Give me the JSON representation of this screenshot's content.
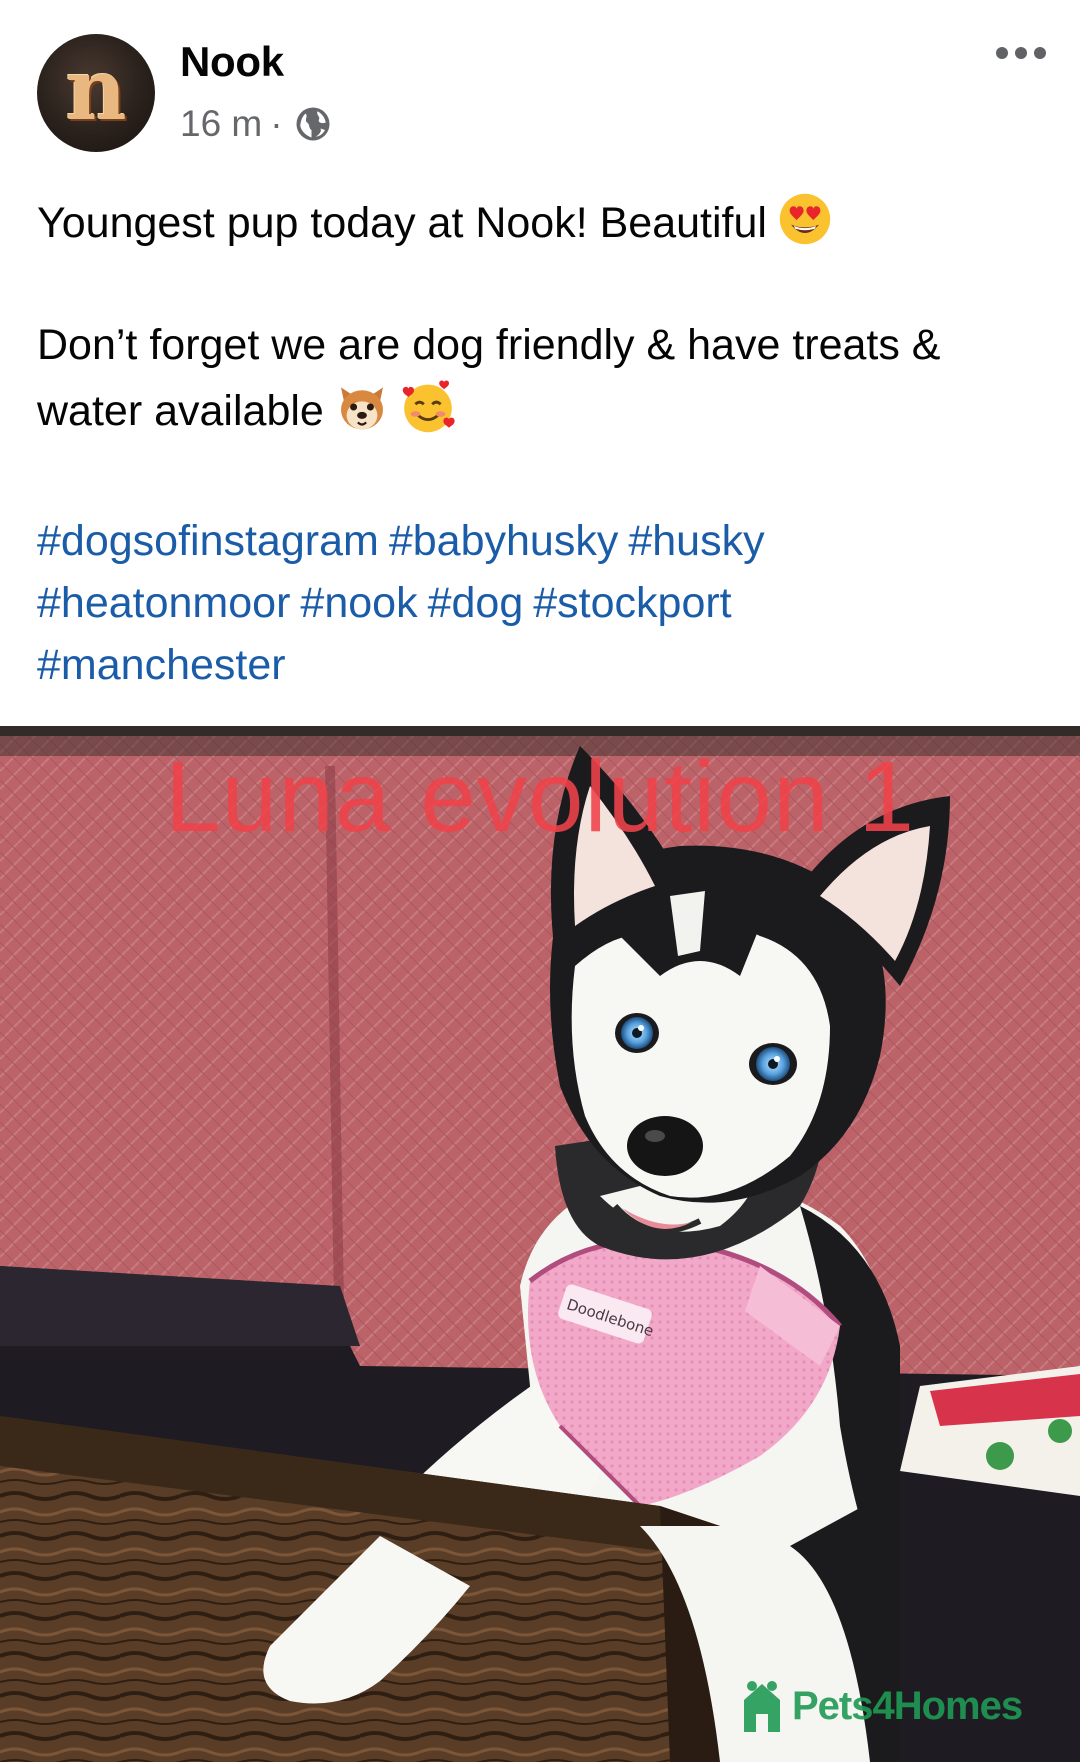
{
  "post": {
    "author": "Nook",
    "avatar_letter": "n",
    "time": "16 m",
    "separator": "·",
    "privacy_icon": "globe-icon",
    "more_icon": "more-options-icon",
    "text_line1": "Youngest pup today at Nook! Beautiful",
    "text_line1_emoji": "heart-eyes-emoji",
    "text_line2": "Don’t forget we are dog friendly & have treats & water available",
    "text_line2_emojis": [
      "dog-face-emoji",
      "smiling-face-with-hearts-emoji"
    ],
    "hashtags": [
      "#dogsofinstagram",
      "#babyhusky",
      "#husky",
      "#heatonmoor",
      "#nook",
      "#dog",
      "#stockport",
      "#manchester"
    ]
  },
  "photo": {
    "overlay_caption": "Luna evolution 1",
    "harness_label": "Doodlebone",
    "watermark_text": "Pets4Homes"
  },
  "colors": {
    "hashtag": "#1b5ca8",
    "meta": "#65676b",
    "caption": "#f0424a",
    "watermark": "#1f9a54"
  }
}
